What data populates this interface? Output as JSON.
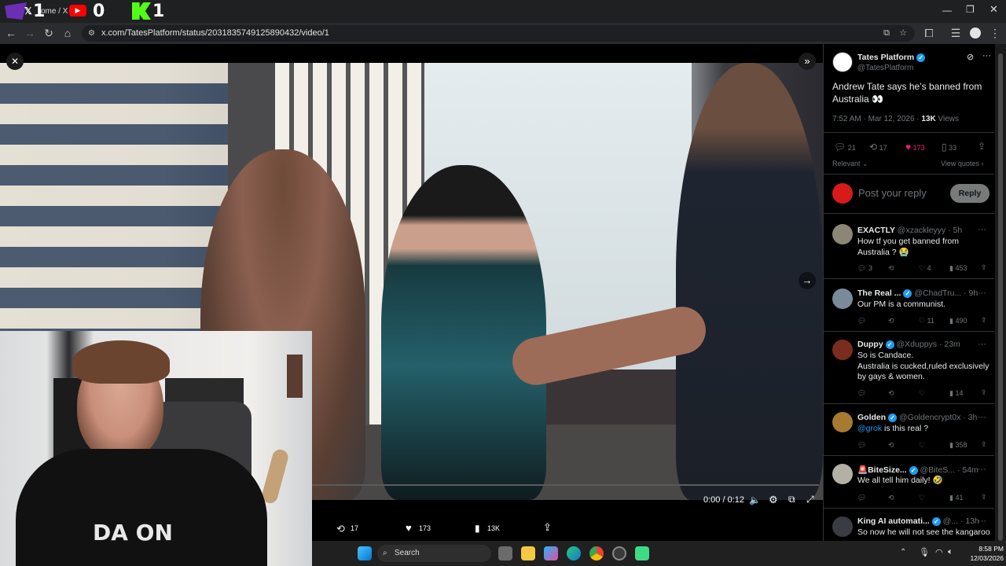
{
  "overlay": {
    "left_score": "1",
    "mid_score": "0",
    "right_score": "1",
    "tab_title": "ome / X"
  },
  "browser": {
    "url": "x.com/TatesPlatform/status/2031835749125890432/video/1"
  },
  "video": {
    "time": "0:00 / 0:12",
    "retweets": "17",
    "likes": "173",
    "views": "13K"
  },
  "post": {
    "author_name": "Tates Platform",
    "author_handle": "@TatesPlatform",
    "text": "Andrew Tate says he’s banned from Australia 👀",
    "timestamp": "7:52 AM · Mar 12, 2026 · ",
    "views_count": "13K",
    "views_label": " Views",
    "replies": "21",
    "retweets": "17",
    "likes": "173",
    "bookmarks": "33",
    "sort_label": "Relevant",
    "quotes_link": "View quotes",
    "reply_placeholder": "Post your reply",
    "reply_button": "Reply"
  },
  "replies": [
    {
      "name": "EXACTLY",
      "handle": "@xzackleyyy · 5h",
      "text": "How tf you get banned from Australia ? 😭",
      "replies": "3",
      "likes": "4",
      "views": "453"
    },
    {
      "name": "The Real ...",
      "handle": "@ChadTru... · 9h",
      "text": "Our PM is a communist.",
      "replies": "",
      "likes": "11",
      "views": "490"
    },
    {
      "name": "Duppy",
      "handle": "@Xduppys · 23m",
      "text": "So is Candace.\nAustralia is cucked,ruled exclusively by gays & women.",
      "replies": "",
      "likes": "",
      "views": "14"
    },
    {
      "name": "Golden",
      "handle": "@Goldencrypt0x · 3h",
      "mention": "@grok",
      "text": " is this real ?",
      "replies": "",
      "likes": "",
      "views": "358"
    },
    {
      "name": "🚨BiteSize...",
      "handle": "@BiteS... · 54m",
      "text": "We all tell him daily! 🤣",
      "replies": "",
      "likes": "",
      "views": "41"
    },
    {
      "name": "King AI automati...",
      "handle": "@... · 13h",
      "text": "So now he will not see the kangaroo",
      "replies": "",
      "likes": "",
      "views": ""
    }
  ],
  "webcam": {
    "shirt_text": "DA ON"
  },
  "taskbar": {
    "search_label": "Search",
    "time": "8:58 PM",
    "date": "12/03/2026"
  },
  "colors": {
    "accent": "#1d9bf0",
    "like_pink": "#f91880",
    "bg": "#000000"
  }
}
